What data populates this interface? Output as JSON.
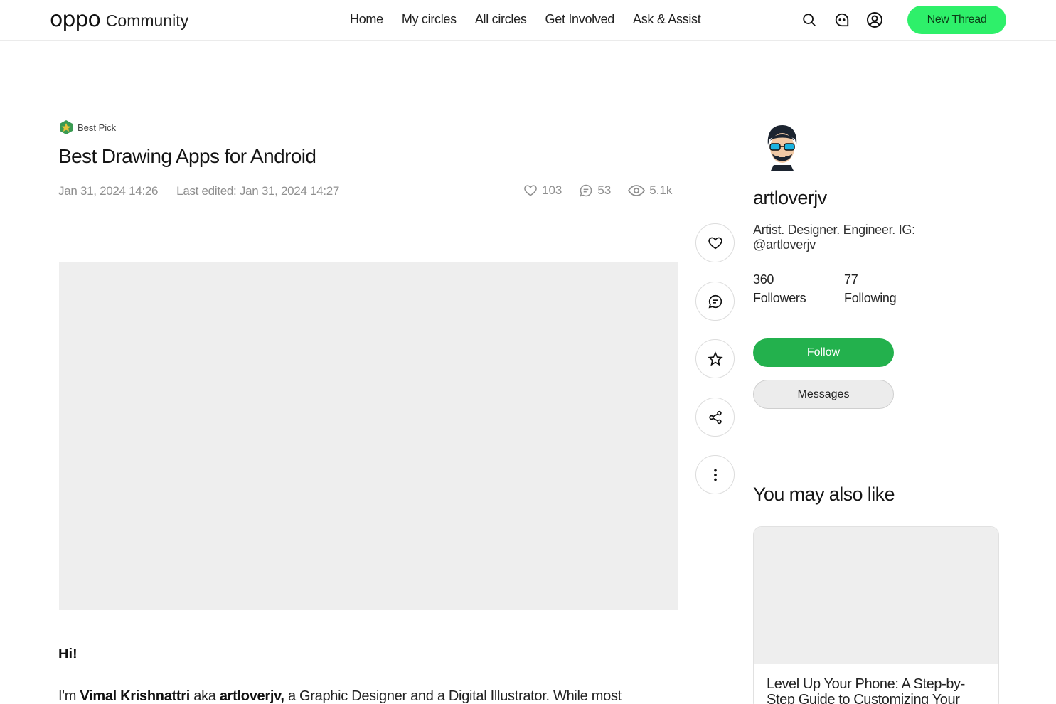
{
  "header": {
    "brand": "oppo",
    "brand_sub": "Community",
    "nav": [
      "Home",
      "My circles",
      "All circles",
      "Get Involved",
      "Ask & Assist"
    ],
    "new_thread_label": "New Thread"
  },
  "post": {
    "badge": "Best Pick",
    "title": "Best Drawing Apps for Android",
    "posted": "Jan 31, 2024 14:26",
    "edited": "Last edited: Jan 31, 2024 14:27",
    "likes": "103",
    "comments": "53",
    "views": "5.1k",
    "greeting": "Hi!",
    "intro": {
      "p1": "I'm ",
      "name": "Vimal Krishnattri",
      "p2": " aka ",
      "handle": "artloverjv,",
      "p3": " a Graphic Designer and a Digital Illustrator. While most"
    }
  },
  "author": {
    "username": "artloverjv",
    "bio": "Artist. Designer. Engineer. IG: @artloverjv",
    "followers_count": "360",
    "followers_label": "Followers",
    "following_count": "77",
    "following_label": "Following",
    "follow_label": "Follow",
    "messages_label": "Messages"
  },
  "recommendations": {
    "heading": "You may also like",
    "cards": [
      {
        "title": "Level Up Your Phone: A Step-by-Step Guide to Customizing Your"
      }
    ]
  },
  "colors": {
    "accent_new_thread": "#2ef06a",
    "follow_green": "#23b14d",
    "placeholder_gray": "#eeeeee"
  }
}
